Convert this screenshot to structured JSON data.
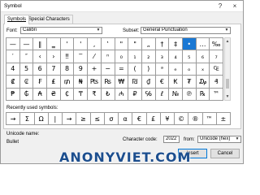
{
  "window": {
    "title": "Symbol",
    "help_icon": "?",
    "close_icon": "×"
  },
  "tabs": [
    {
      "label": "Symbols",
      "active": true
    },
    {
      "label": "Special Characters",
      "active": false
    }
  ],
  "font": {
    "label": "Font:",
    "value": "Calibri"
  },
  "subset": {
    "label": "Subset:",
    "value": "General Punctuation"
  },
  "symbol_grid": {
    "rows": [
      [
        "—",
        "—",
        "‖",
        "‗",
        "'",
        "'",
        "‚",
        "‛",
        "\"",
        "\"",
        "„",
        "†",
        "‡",
        "•",
        "…",
        "‰"
      ],
      [
        "′",
        "″",
        "‹",
        "›",
        "‼",
        "‾",
        "⁄",
        "ⁿ",
        "₀",
        "₁",
        "₂",
        "₃",
        "₄",
        "₅",
        "₆",
        "₇"
      ],
      [
        "4",
        "5",
        "6",
        "7",
        "8",
        "9",
        "+",
        "−",
        "=",
        "(",
        ")",
        "ᵃ",
        "ₑ",
        "ₒ",
        "ₓ",
        "₠"
      ],
      [
        "₡",
        "₢",
        "₣",
        "₤",
        "₥",
        "₦",
        "₧",
        "₨",
        "₩",
        "₪",
        "₫",
        "€",
        "₭",
        "₮",
        "₯",
        "₰"
      ],
      [
        "₱",
        "₲",
        "₳",
        "₴",
        "₵",
        "₸",
        "₹",
        "₺",
        "₼",
        "₽",
        "℅",
        "ℓ",
        "№",
        "℗",
        "℞",
        "™"
      ]
    ],
    "selected": "•"
  },
  "recently_used": {
    "label": "Recently used symbols:",
    "symbols": [
      "→",
      "Σ",
      "Ω",
      "|",
      "→",
      "≥",
      "≤",
      "σ",
      "α",
      "€",
      "£",
      "¥",
      "©",
      "®",
      "™",
      "±"
    ]
  },
  "unicode_name": {
    "label": "Unicode name:",
    "value": "Bullet"
  },
  "character_code": {
    "label": "Character code:",
    "value": "2022"
  },
  "from": {
    "label": "from:",
    "value": "Unicode (hex)"
  },
  "buttons": {
    "insert": "Insert",
    "cancel": "Cancel"
  },
  "watermark": "ANONYVIET.COM"
}
